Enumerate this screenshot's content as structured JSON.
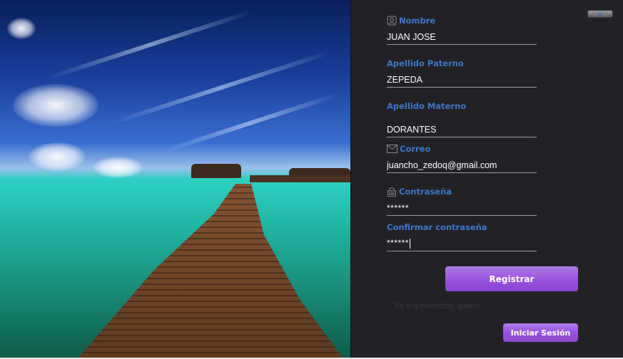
{
  "window": {
    "close_label": "x"
  },
  "form": {
    "nombre": {
      "label": "Nombre",
      "value": "JUAN JOSE",
      "icon": "user-icon"
    },
    "apellido_paterno": {
      "label": "Apellido Paterno",
      "value": "ZEPEDA"
    },
    "apellido_materno": {
      "label": "Apellido Materno",
      "value": "DORANTES"
    },
    "correo": {
      "label": "Correo",
      "value": "juancho_zedoq@gmail.com",
      "icon": "mail-icon"
    },
    "contrasena": {
      "label": "Contraseña",
      "value": "******",
      "icon": "lock-icon"
    },
    "confirmar_contrasena": {
      "label": "Confirmar contraseña",
      "value": "******"
    }
  },
  "actions": {
    "register_label": "Registrar",
    "member_text": "Ya soy miembro, quiero",
    "login_label": "Iniciar Sesión"
  },
  "colors": {
    "panel_bg": "#222226",
    "label_blue": "#3d77c9",
    "button_purple": "#9752dc"
  }
}
